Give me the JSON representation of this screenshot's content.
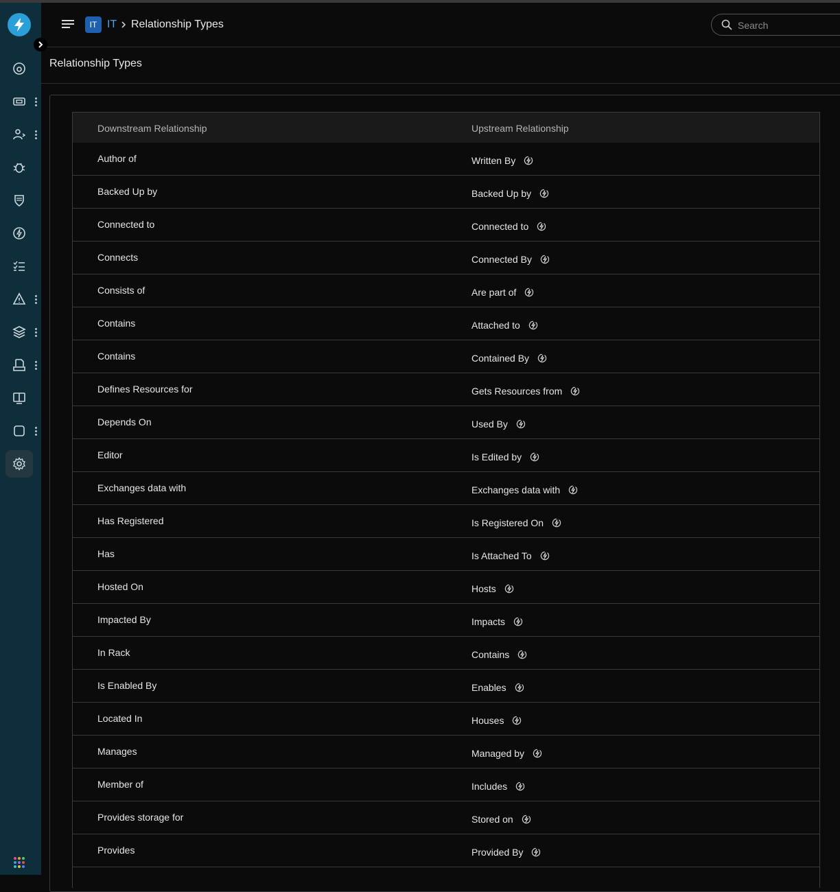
{
  "header": {
    "breadcrumb_badge": "IT",
    "breadcrumb_link": "IT",
    "breadcrumb_current": "Relationship Types",
    "search_placeholder": "Search"
  },
  "page": {
    "title": "Relationship Types"
  },
  "sidebar": {
    "items": [
      {
        "name": "dashboard-icon",
        "menu": false
      },
      {
        "name": "ticket-icon",
        "menu": true
      },
      {
        "name": "user-exchange-icon",
        "menu": true
      },
      {
        "name": "bug-icon",
        "menu": false
      },
      {
        "name": "shield-icon",
        "menu": false
      },
      {
        "name": "bolt-icon",
        "menu": false
      },
      {
        "name": "checklist-icon",
        "menu": false
      },
      {
        "name": "alert-icon",
        "menu": true
      },
      {
        "name": "layers-icon",
        "menu": true
      },
      {
        "name": "document-user-icon",
        "menu": true
      },
      {
        "name": "book-icon",
        "menu": false
      },
      {
        "name": "square-icon",
        "menu": true
      },
      {
        "name": "gear-icon",
        "menu": false,
        "active": true
      }
    ]
  },
  "table": {
    "headers": [
      "Downstream Relationship",
      "Upstream Relationship"
    ],
    "rows": [
      {
        "downstream": "Author of",
        "upstream": "Written By"
      },
      {
        "downstream": "Backed Up by",
        "upstream": "Backed Up by"
      },
      {
        "downstream": "Connected to",
        "upstream": "Connected to"
      },
      {
        "downstream": "Connects",
        "upstream": "Connected By"
      },
      {
        "downstream": "Consists of",
        "upstream": "Are part of"
      },
      {
        "downstream": "Contains",
        "upstream": "Attached to"
      },
      {
        "downstream": "Contains",
        "upstream": "Contained By"
      },
      {
        "downstream": "Defines Resources for",
        "upstream": "Gets Resources from"
      },
      {
        "downstream": "Depends On",
        "upstream": "Used By"
      },
      {
        "downstream": "Editor",
        "upstream": "Is Edited by"
      },
      {
        "downstream": "Exchanges data with",
        "upstream": "Exchanges data with"
      },
      {
        "downstream": "Has Registered",
        "upstream": "Is Registered On"
      },
      {
        "downstream": "Has",
        "upstream": "Is Attached To"
      },
      {
        "downstream": "Hosted On",
        "upstream": "Hosts"
      },
      {
        "downstream": "Impacted By",
        "upstream": "Impacts"
      },
      {
        "downstream": "In Rack",
        "upstream": "Contains"
      },
      {
        "downstream": "Is Enabled By",
        "upstream": "Enables"
      },
      {
        "downstream": "Located In",
        "upstream": "Houses"
      },
      {
        "downstream": "Manages",
        "upstream": "Managed by"
      },
      {
        "downstream": "Member of",
        "upstream": "Includes"
      },
      {
        "downstream": "Provides storage for",
        "upstream": "Stored on"
      },
      {
        "downstream": "Provides",
        "upstream": "Provided By"
      },
      {
        "downstream": "",
        "upstream": ""
      }
    ]
  },
  "colors": {
    "sidebar": "#0f2e3c",
    "accent": "#2a9fd8",
    "link": "#4d9fe8",
    "badge": "#1f5fb0"
  }
}
